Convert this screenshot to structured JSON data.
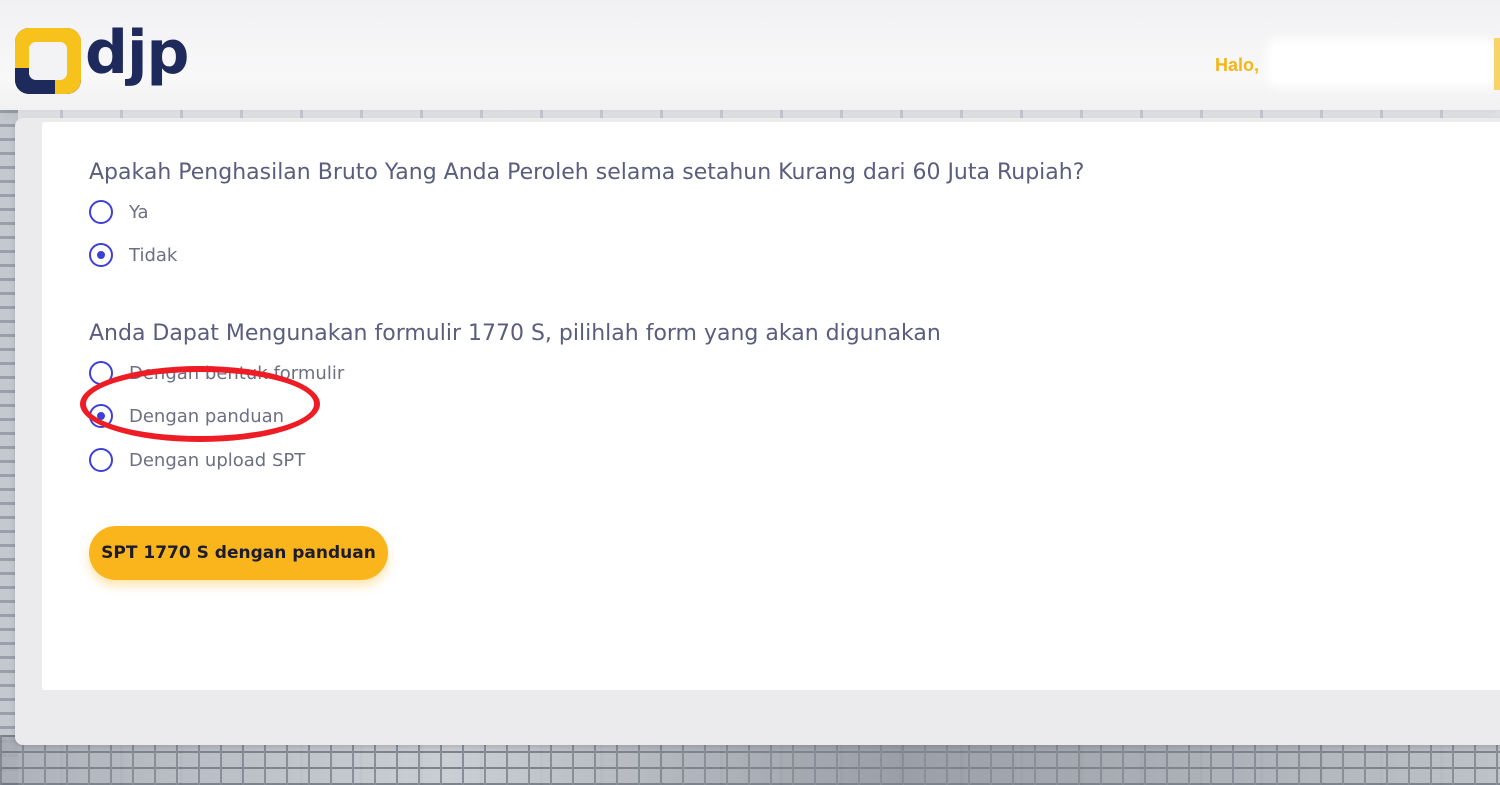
{
  "header": {
    "logo_text": "djp",
    "greeting": "Halo,",
    "user_name": ""
  },
  "form": {
    "question1": {
      "text": "Apakah Penghasilan Bruto Yang Anda Peroleh selama setahun Kurang dari 60 Juta Rupiah?",
      "options": [
        {
          "label": "Ya",
          "checked": false
        },
        {
          "label": "Tidak",
          "checked": true
        }
      ]
    },
    "question2": {
      "text": "Anda Dapat Mengunakan formulir 1770 S, pilihlah form yang akan digunakan",
      "options": [
        {
          "label": "Dengan bentuk formulir",
          "checked": false
        },
        {
          "label": "Dengan panduan",
          "checked": true
        },
        {
          "label": "Dengan upload SPT",
          "checked": false
        }
      ]
    },
    "submit_label": "SPT 1770 S dengan panduan"
  },
  "colors": {
    "accent_yellow": "#fab51d",
    "radio_blue": "#3d40d8",
    "question_text": "#5a5d7e",
    "annotation_red": "#ee1c25",
    "logo_navy": "#1f2a5c"
  }
}
